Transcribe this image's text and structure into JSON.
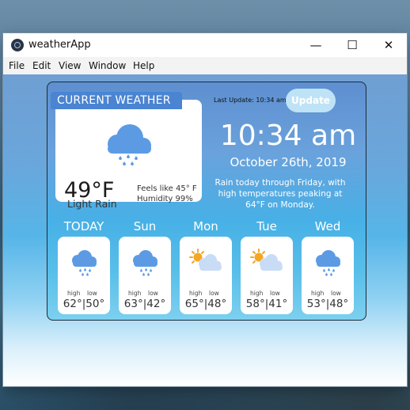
{
  "window": {
    "title": "weatherApp"
  },
  "menu": [
    "File",
    "Edit",
    "View",
    "Window",
    "Help"
  ],
  "current": {
    "header": "CURRENT WEATHER",
    "temp": "49°F",
    "condition": "Light Rain",
    "feels_like": "Feels like 45° F",
    "humidity": "Humidity 99%",
    "icon": "rain-cloud-icon"
  },
  "last_update": "Last Update: 10:34 am",
  "update_button": "Update",
  "clock": "10:34 am",
  "date": "October 26th, 2019",
  "forecast_text": "Rain today through Friday, with high temperatures peaking at 64°F on Monday.",
  "days": [
    {
      "name": "TODAY",
      "icon": "rain-cloud-icon",
      "high_label": "high",
      "low_label": "low",
      "temps": "62°|50°"
    },
    {
      "name": "Sun",
      "icon": "rain-cloud-icon",
      "high_label": "high",
      "low_label": "low",
      "temps": "63°|42°"
    },
    {
      "name": "Mon",
      "icon": "partly-cloudy-icon",
      "high_label": "high",
      "low_label": "low",
      "temps": "65°|48°"
    },
    {
      "name": "Tue",
      "icon": "partly-cloudy-icon",
      "high_label": "high",
      "low_label": "low",
      "temps": "58°|41°"
    },
    {
      "name": "Wed",
      "icon": "rain-cloud-icon",
      "high_label": "high",
      "low_label": "low",
      "temps": "53°|48°"
    }
  ],
  "colors": {
    "accent": "#4a84d2",
    "update_button": "#bfe3f6",
    "cloud": "#5c9be4"
  }
}
